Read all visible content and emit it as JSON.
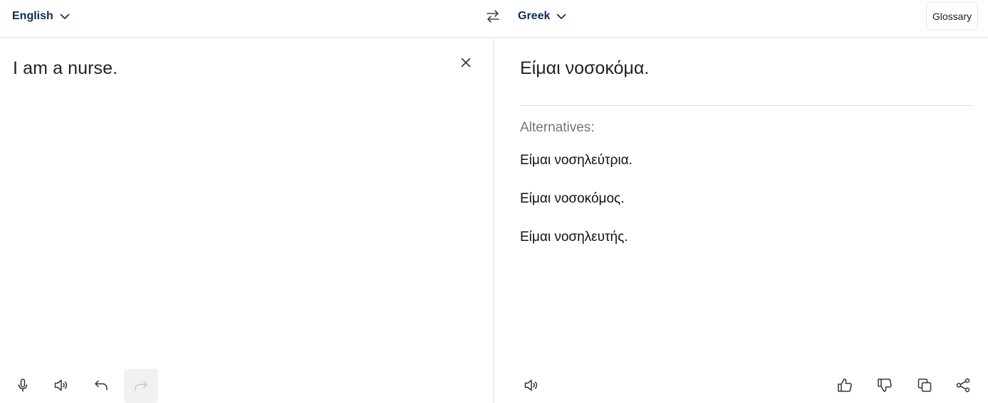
{
  "header": {
    "source_language": "English",
    "target_language": "Greek",
    "glossary_label": "Glossary",
    "icons": {
      "dropdown": "chevron-down-icon",
      "swap": "swap-arrows-icon"
    }
  },
  "source_panel": {
    "text": "I am a nurse.",
    "icons": [
      "clear-icon",
      "microphone-icon",
      "speaker-icon",
      "undo-icon",
      "redo-icon"
    ]
  },
  "target_panel": {
    "translation": "Είμαι νοσοκόμα.",
    "alternatives_heading": "Alternatives:",
    "alternatives": [
      "Είμαι νοσηλεύτρια.",
      "Είμαι νοσοκόμος.",
      "Είμαι νοσηλευτής."
    ],
    "icons": [
      "speaker-icon",
      "thumbs-up-icon",
      "thumbs-down-icon",
      "copy-icon",
      "share-icon"
    ]
  },
  "colors": {
    "accent": "#0f2b5b",
    "muted": "#757575",
    "divider": "#e3e3e3",
    "disabled_bg": "#f1f1f1"
  }
}
